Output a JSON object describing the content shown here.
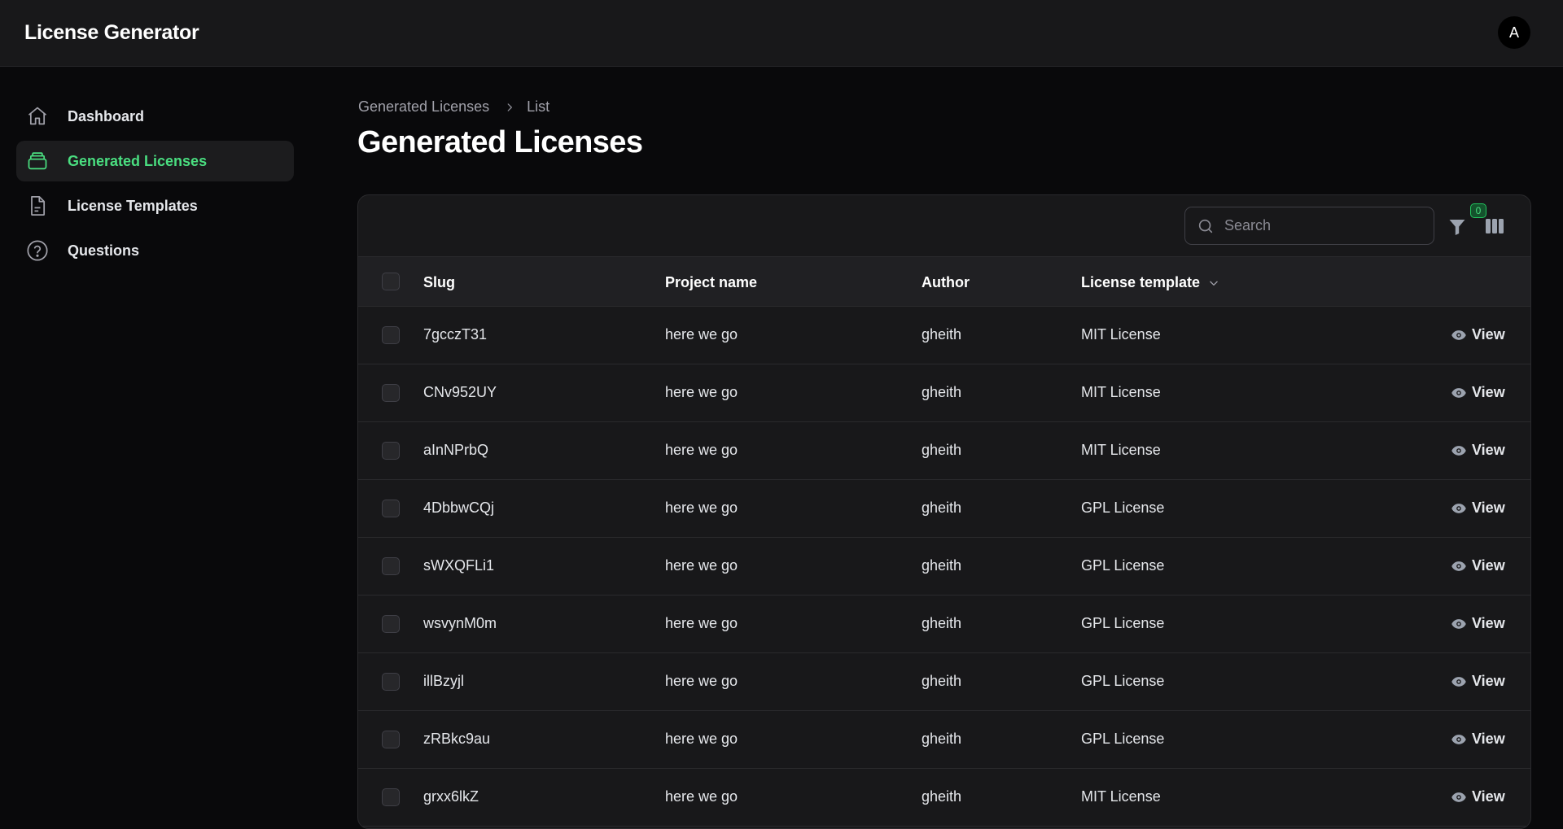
{
  "app": {
    "title": "License Generator",
    "avatar_initial": "A"
  },
  "sidebar": {
    "items": [
      {
        "label": "Dashboard",
        "icon": "home-icon",
        "active": false
      },
      {
        "label": "Generated Licenses",
        "icon": "stack-icon",
        "active": true
      },
      {
        "label": "License Templates",
        "icon": "document-icon",
        "active": false
      },
      {
        "label": "Questions",
        "icon": "question-circle-icon",
        "active": false
      }
    ]
  },
  "breadcrumb": {
    "parent": "Generated Licenses",
    "current": "List"
  },
  "page": {
    "title": "Generated Licenses"
  },
  "toolbar": {
    "search_placeholder": "Search",
    "search_value": "",
    "filter_count": "0"
  },
  "table": {
    "columns": {
      "slug": "Slug",
      "project_name": "Project name",
      "author": "Author",
      "license_template": "License template"
    },
    "view_label": "View",
    "rows": [
      {
        "slug": "7gcczT31",
        "project_name": "here we go",
        "author": "gheith",
        "license_template": "MIT License"
      },
      {
        "slug": "CNv952UY",
        "project_name": "here we go",
        "author": "gheith",
        "license_template": "MIT License"
      },
      {
        "slug": "aInNPrbQ",
        "project_name": "here we go",
        "author": "gheith",
        "license_template": "MIT License"
      },
      {
        "slug": "4DbbwCQj",
        "project_name": "here we go",
        "author": "gheith",
        "license_template": "GPL License"
      },
      {
        "slug": "sWXQFLi1",
        "project_name": "here we go",
        "author": "gheith",
        "license_template": "GPL License"
      },
      {
        "slug": "wsvynM0m",
        "project_name": "here we go",
        "author": "gheith",
        "license_template": "GPL License"
      },
      {
        "slug": "illBzyjl",
        "project_name": "here we go",
        "author": "gheith",
        "license_template": "GPL License"
      },
      {
        "slug": "zRBkc9au",
        "project_name": "here we go",
        "author": "gheith",
        "license_template": "GPL License"
      },
      {
        "slug": "grxx6lkZ",
        "project_name": "here we go",
        "author": "gheith",
        "license_template": "MIT License"
      }
    ]
  },
  "colors": {
    "accent": "#4ade80",
    "background": "#09090b",
    "surface": "#18181a"
  }
}
